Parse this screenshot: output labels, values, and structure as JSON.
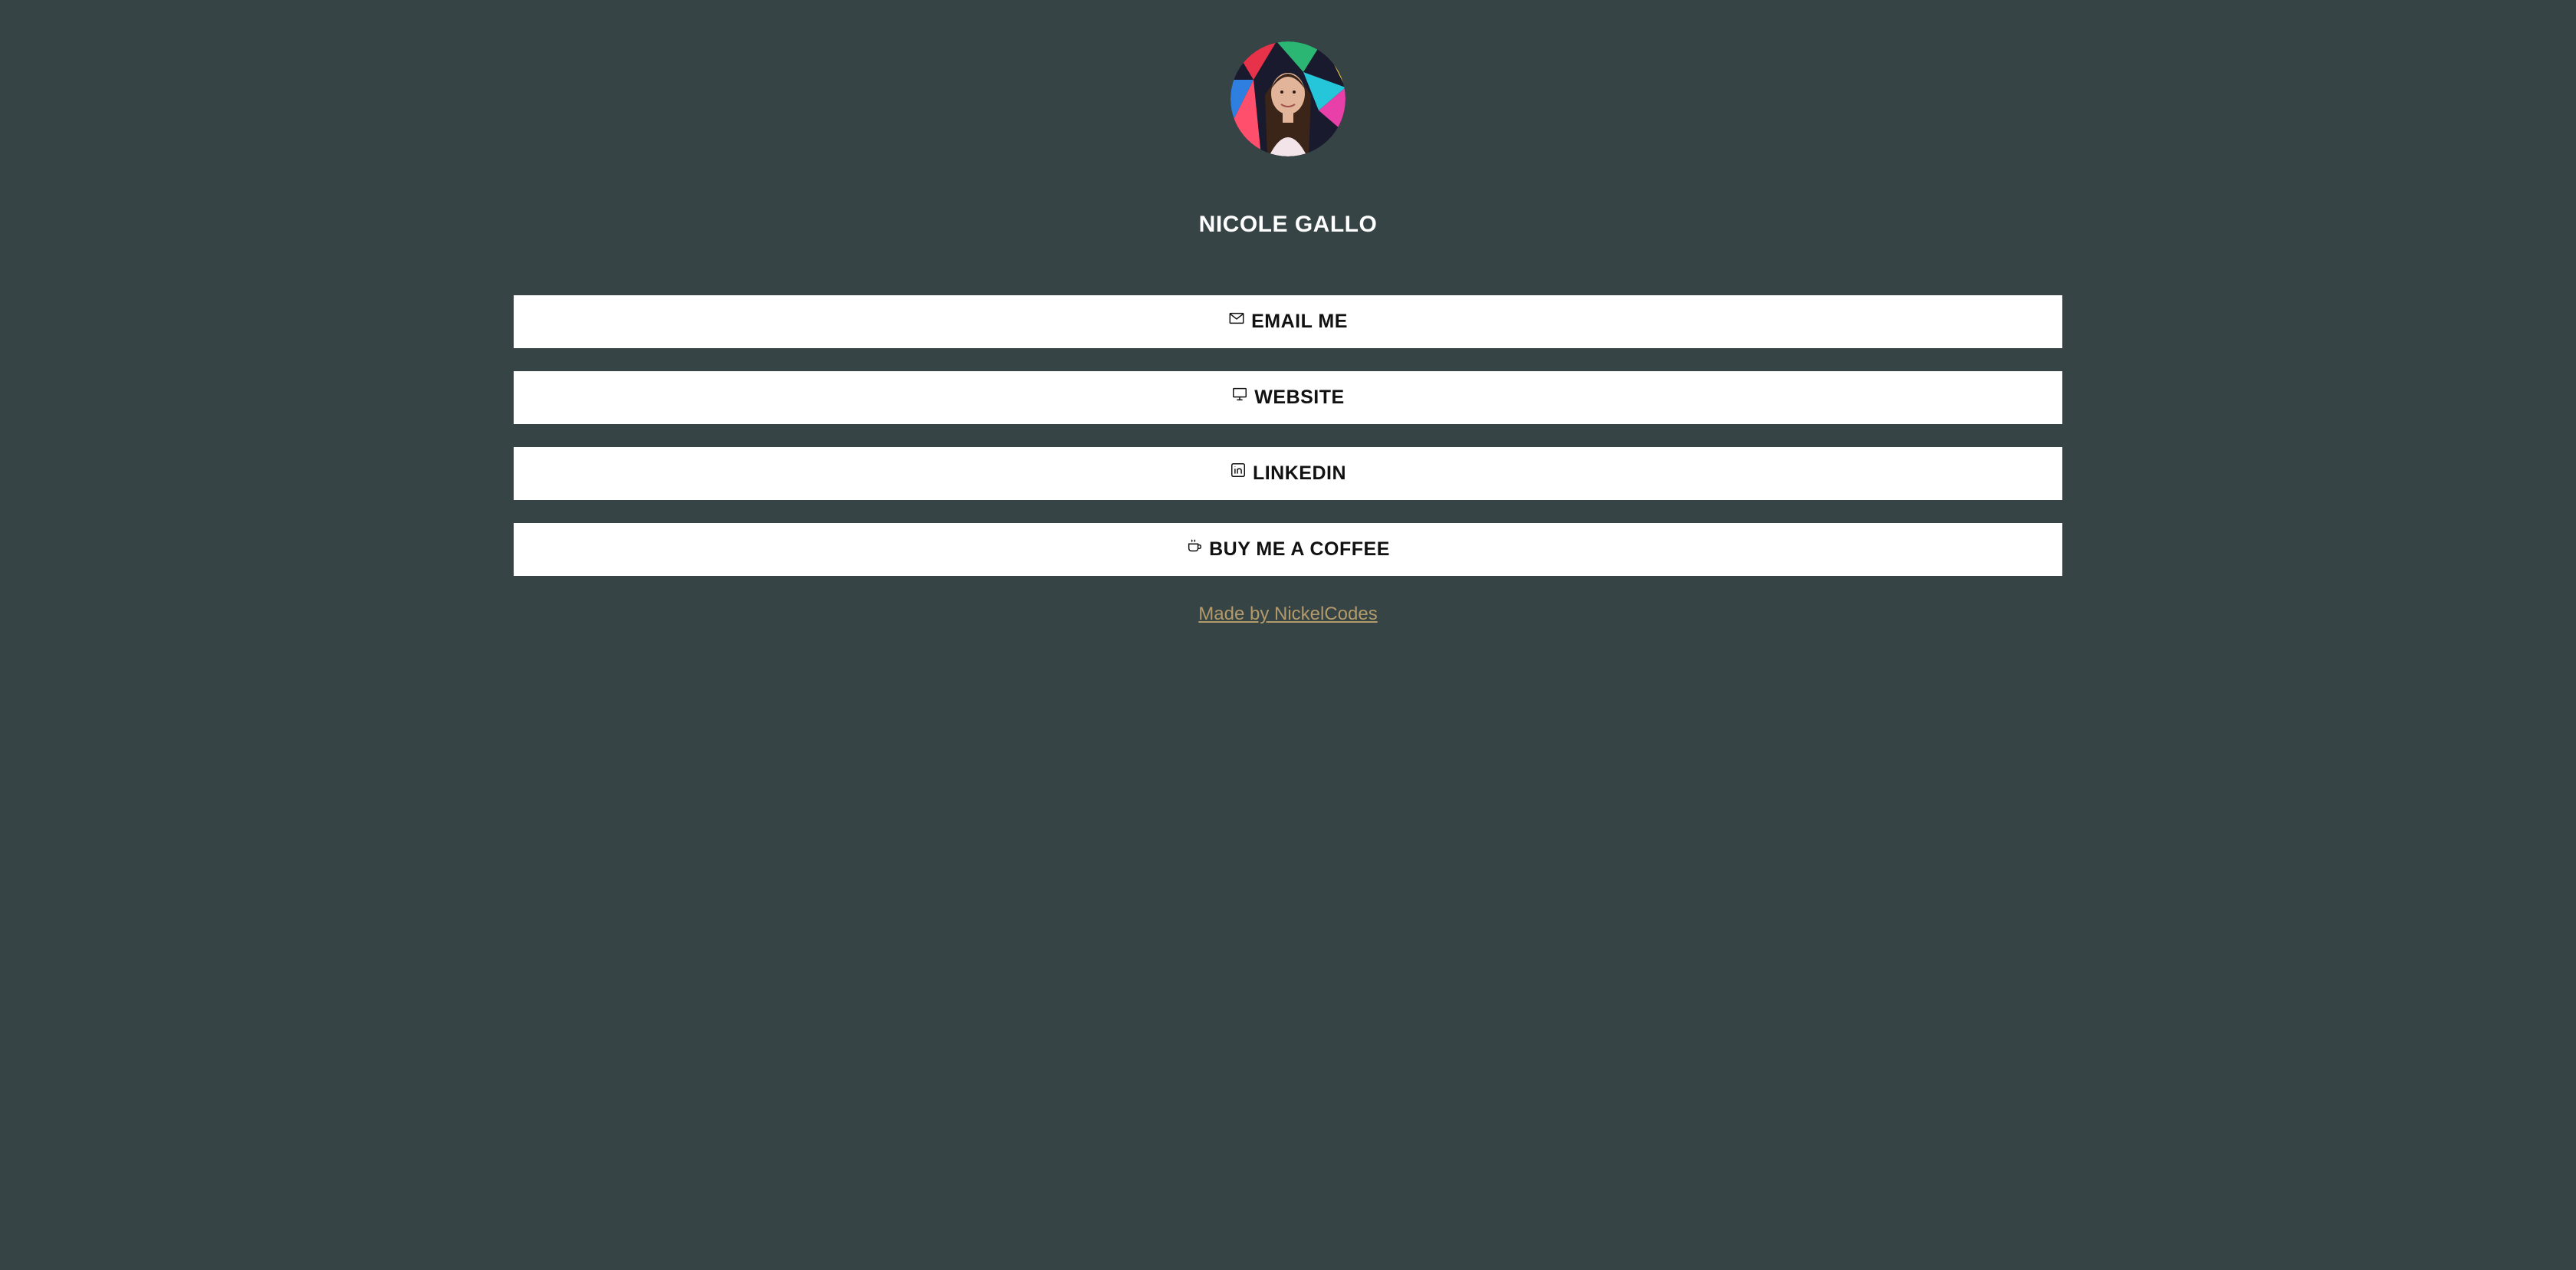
{
  "profile": {
    "name": "NICOLE GALLO",
    "avatar_icon": "profile-photo"
  },
  "links": [
    {
      "label": "EMAIL ME",
      "icon": "envelope-icon"
    },
    {
      "label": "WEBSITE",
      "icon": "monitor-icon"
    },
    {
      "label": "LINKEDIN",
      "icon": "linkedin-icon"
    },
    {
      "label": "BUY ME A COFFEE",
      "icon": "coffee-cup-icon"
    }
  ],
  "footer": {
    "credit": "Made by NickelCodes"
  },
  "colors": {
    "background": "#364446",
    "button": "#ffffff",
    "button_text": "#111111",
    "credit_link": "#b39a6a"
  }
}
